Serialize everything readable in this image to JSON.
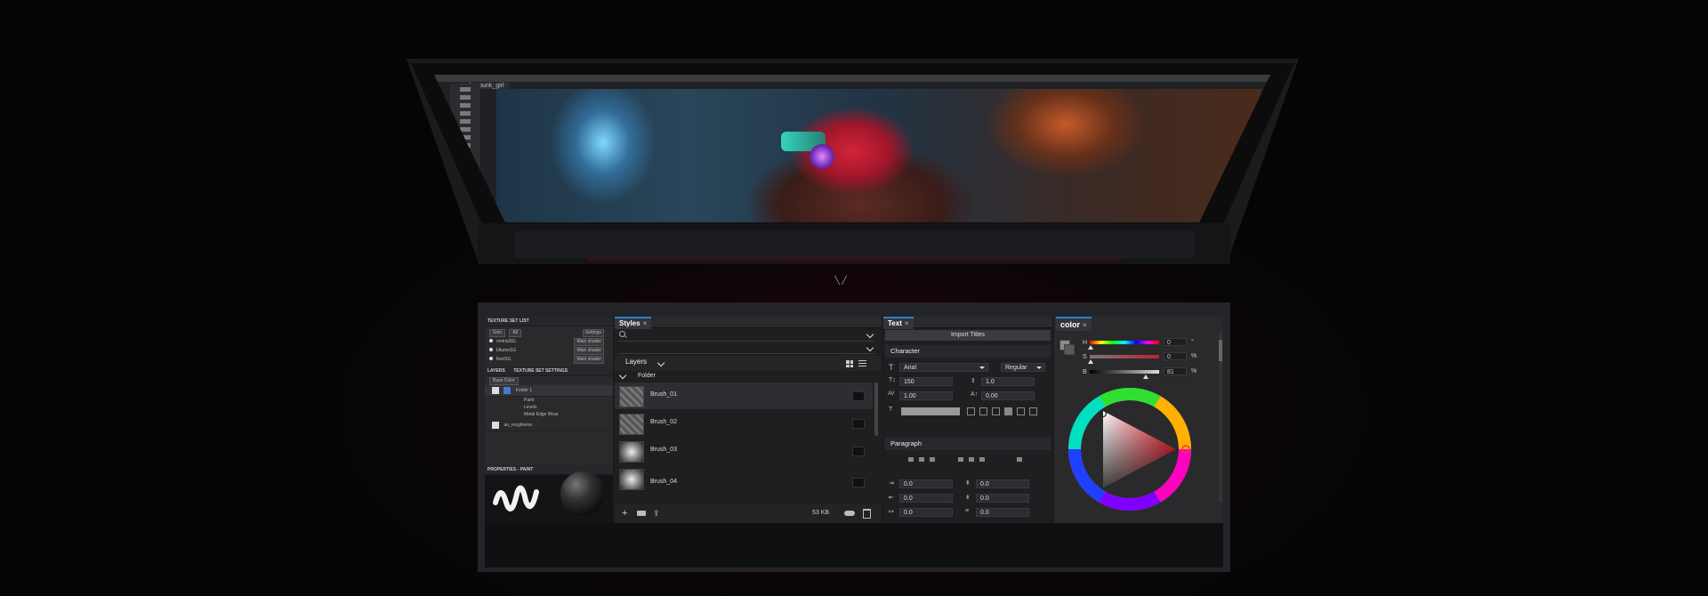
{
  "top_screen": {
    "tab_label": "cyberpunk_girl"
  },
  "texture_panel": {
    "header": "TEXTURE SET LIST",
    "tabs": [
      "Solo",
      "All"
    ],
    "settings_label": "Settings",
    "sets": [
      {
        "name": "vmtrialSG",
        "shader": "Main shader"
      },
      {
        "name": "bltumeSG",
        "shader": "Main shader"
      },
      {
        "name": "finelSG",
        "shader": "Main shader"
      }
    ],
    "layers_tab": "LAYERS",
    "settings_tab": "TEXTURE SET SETTINGS",
    "channel": "Base Color",
    "layers": [
      {
        "name": "Folder 1",
        "blend": "Norm",
        "opacity": "100"
      },
      {
        "name": "Paint",
        "blend": "Norm",
        "opacity": "100"
      },
      {
        "name": "Levels",
        "blend": "",
        "opacity": ""
      },
      {
        "name": "Metal Edge Wear",
        "blend": "Norm",
        "opacity": "100"
      },
      {
        "name": "ao_roughness",
        "blend": "Pt.E",
        "opacity": "100"
      }
    ],
    "properties_header": "PROPERTIES - PAINT"
  },
  "styles_panel": {
    "tab_label": "Styles",
    "close_glyph": "×",
    "layers_label": "Layers",
    "folder_label": "Folder",
    "brushes": [
      "Brush_01",
      "Brush_02",
      "Brush_03",
      "Brush_04"
    ],
    "size_label": "53 KB"
  },
  "text_panel": {
    "tab_label": "Text",
    "close_glyph": "×",
    "import_label": "Import Titles",
    "character_header": "Character",
    "font_family": "Arial",
    "font_style": "Regular",
    "font_size": "150",
    "leading": "1.0",
    "tracking": "1.00",
    "baseline": "0.00",
    "paragraph_header": "Paragraph",
    "para_values": [
      "0.0",
      "0.0",
      "0.0",
      "0.0",
      "0.0",
      "0.0"
    ]
  },
  "color_panel": {
    "tab_label": "color",
    "close_glyph": "×",
    "h_label": "H",
    "s_label": "S",
    "b_label": "B",
    "h_value": "0",
    "s_value": "0",
    "b_value": "81",
    "h_unit": "°",
    "s_unit": "%",
    "b_unit": "%",
    "colors": {
      "accent": "#2f7fd8",
      "selected_hue": "#ff3040"
    }
  }
}
